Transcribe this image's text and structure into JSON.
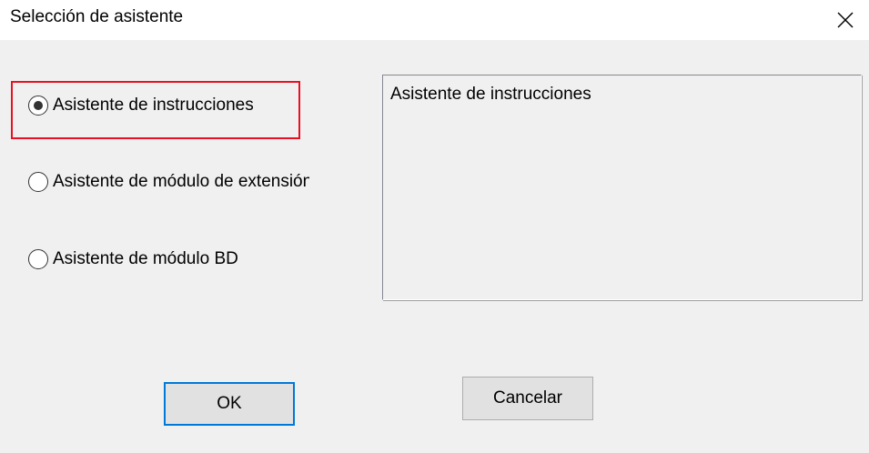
{
  "window": {
    "title": "Selección de asistente"
  },
  "options": [
    {
      "label": "Asistente de instrucciones",
      "checked": true
    },
    {
      "label": "Asistente de módulo de extensión",
      "checked": false
    },
    {
      "label": "Asistente de módulo BD",
      "checked": false
    }
  ],
  "description": {
    "text": "Asistente de instrucciones"
  },
  "buttons": {
    "ok_label": "OK",
    "cancel_label": "Cancelar"
  },
  "colors": {
    "highlight": "#e81123",
    "default_button_border": "#0078d7",
    "dialog_background": "#f0f0f0"
  },
  "icons": {
    "close": "close-icon"
  }
}
